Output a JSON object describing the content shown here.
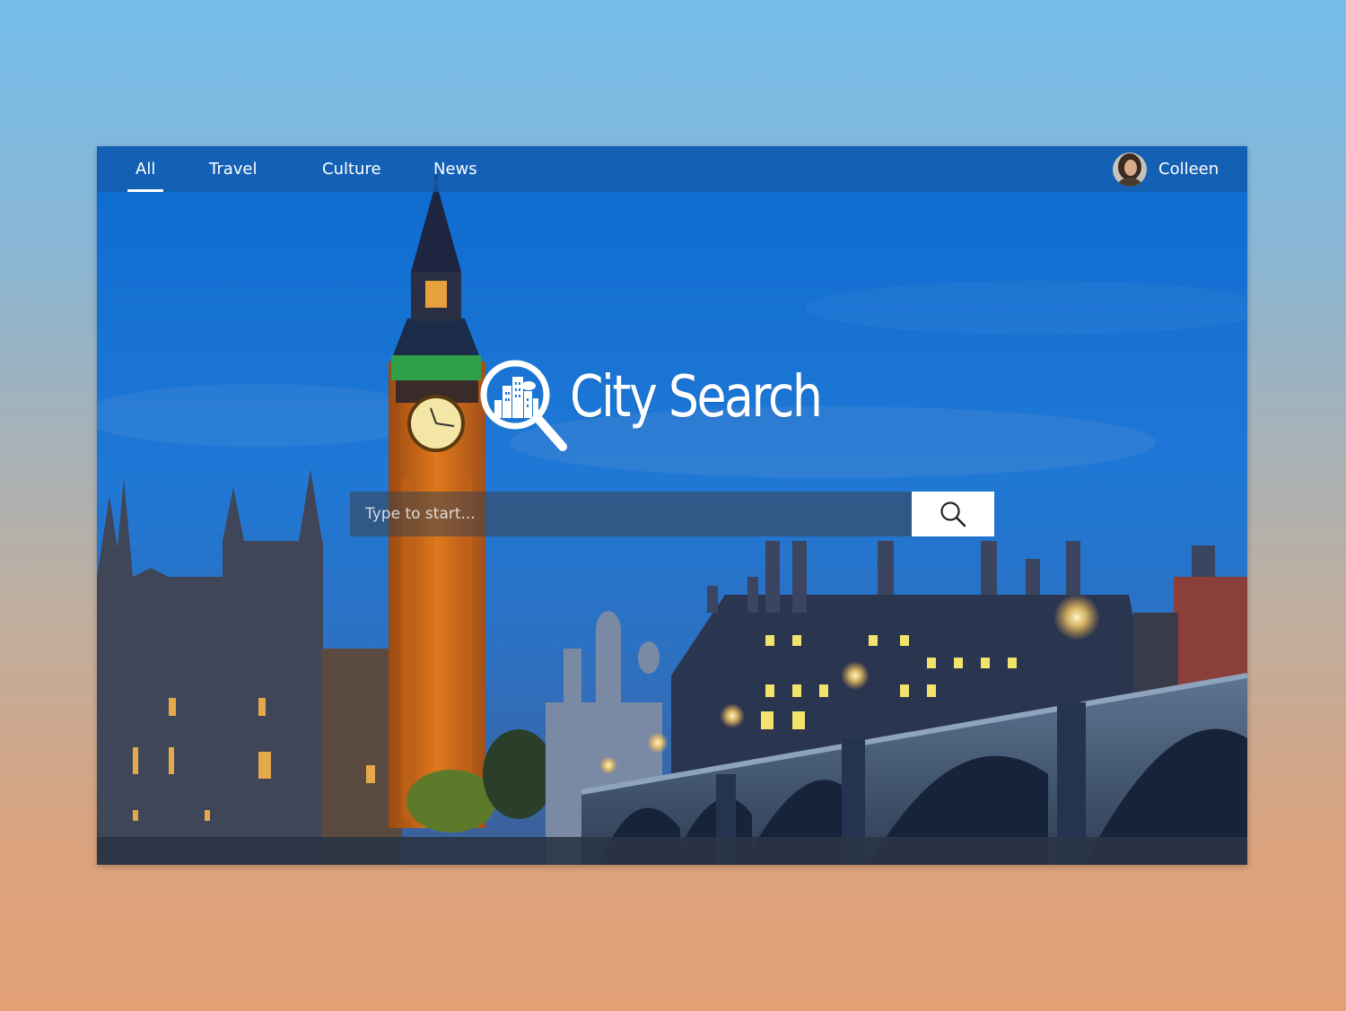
{
  "nav": {
    "tabs": [
      {
        "label": "All",
        "active": true
      },
      {
        "label": "Travel",
        "active": false
      },
      {
        "label": "Culture",
        "active": false
      },
      {
        "label": "News",
        "active": false
      }
    ]
  },
  "user": {
    "name": "Colleen",
    "avatar_icon": "user-avatar"
  },
  "brand": {
    "title": "City Search",
    "logo_icon": "city-magnifier-icon"
  },
  "search": {
    "placeholder": "Type to start...",
    "value": "",
    "button_icon": "search-icon"
  },
  "colors": {
    "nav_bar": "#165caa",
    "text": "#ffffff",
    "search_button": "#ffffff",
    "page_gradient_top": "#74bdea",
    "page_gradient_bottom": "#e3a276"
  }
}
